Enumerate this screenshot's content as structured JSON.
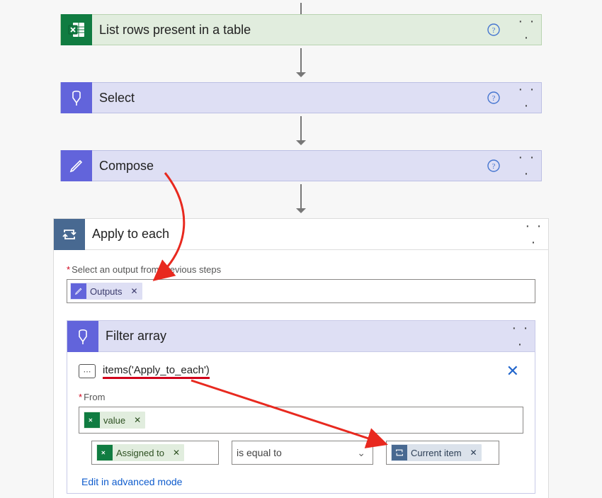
{
  "cards": {
    "excel": {
      "title": "List rows present in a table"
    },
    "select": {
      "title": "Select"
    },
    "compose": {
      "title": "Compose"
    }
  },
  "apply_to_each": {
    "title": "Apply to each",
    "field_label": "Select an output from previous steps",
    "token": "Outputs"
  },
  "filter_array": {
    "title": "Filter array",
    "expression": "items('Apply_to_each')",
    "from_label": "From",
    "from_token": "value",
    "cond_left_token": "Assigned to",
    "cond_operator": "is equal to",
    "cond_right_token": "Current item",
    "advanced_link": "Edit in advanced mode"
  },
  "glyphs": {
    "help": "?",
    "ellipsis": "· · ·",
    "close": "✕",
    "chevron": "⌄",
    "fx": "⋯"
  }
}
